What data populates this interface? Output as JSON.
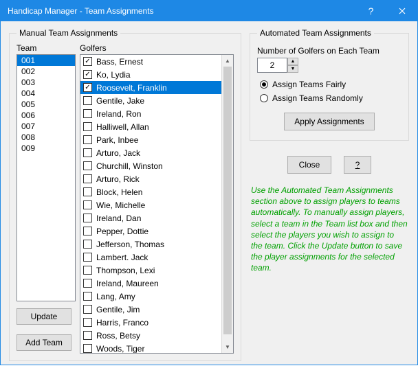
{
  "window": {
    "title": "Handicap Manager - Team Assignments"
  },
  "manual": {
    "legend": "Manual Team Assignments",
    "team_label": "Team",
    "golfers_label": "Golfers",
    "teams": [
      {
        "id": "001",
        "selected": true
      },
      {
        "id": "002",
        "selected": false
      },
      {
        "id": "003",
        "selected": false
      },
      {
        "id": "004",
        "selected": false
      },
      {
        "id": "005",
        "selected": false
      },
      {
        "id": "006",
        "selected": false
      },
      {
        "id": "007",
        "selected": false
      },
      {
        "id": "008",
        "selected": false
      },
      {
        "id": "009",
        "selected": false
      }
    ],
    "golfers": [
      {
        "name": "Bass, Ernest",
        "checked": true,
        "selected": false
      },
      {
        "name": "Ko, Lydia",
        "checked": true,
        "selected": false
      },
      {
        "name": "Roosevelt, Franklin",
        "checked": true,
        "selected": true
      },
      {
        "name": "Gentile, Jake",
        "checked": false,
        "selected": false
      },
      {
        "name": "Ireland, Ron",
        "checked": false,
        "selected": false
      },
      {
        "name": "Halliwell, Allan",
        "checked": false,
        "selected": false
      },
      {
        "name": "Park, Inbee",
        "checked": false,
        "selected": false
      },
      {
        "name": "Arturo, Jack",
        "checked": false,
        "selected": false
      },
      {
        "name": "Churchill, Winston",
        "checked": false,
        "selected": false
      },
      {
        "name": "Arturo, Rick",
        "checked": false,
        "selected": false
      },
      {
        "name": "Block, Helen",
        "checked": false,
        "selected": false
      },
      {
        "name": "Wie, Michelle",
        "checked": false,
        "selected": false
      },
      {
        "name": "Ireland, Dan",
        "checked": false,
        "selected": false
      },
      {
        "name": "Pepper, Dottie",
        "checked": false,
        "selected": false
      },
      {
        "name": "Jefferson, Thomas",
        "checked": false,
        "selected": false
      },
      {
        "name": "Lambert. Jack",
        "checked": false,
        "selected": false
      },
      {
        "name": "Thompson, Lexi",
        "checked": false,
        "selected": false
      },
      {
        "name": "Ireland, Maureen",
        "checked": false,
        "selected": false
      },
      {
        "name": "Lang, Amy",
        "checked": false,
        "selected": false
      },
      {
        "name": "Gentile, Jim",
        "checked": false,
        "selected": false
      },
      {
        "name": "Harris, Franco",
        "checked": false,
        "selected": false
      },
      {
        "name": "Ross, Betsy",
        "checked": false,
        "selected": false
      },
      {
        "name": "Woods, Tiger",
        "checked": false,
        "selected": false
      }
    ],
    "update_label": "Update",
    "add_team_label": "Add Team"
  },
  "automated": {
    "legend": "Automated Team Assignments",
    "num_label": "Number of Golfers on Each Team",
    "num_value": "2",
    "radio_fair": "Assign Teams Fairly",
    "radio_random": "Assign Teams Randomly",
    "radio_selected": "fair",
    "apply_label": "Apply Assignments"
  },
  "actions": {
    "close_label": "Close",
    "help_label": "?"
  },
  "help_text": "Use the Automated Team Assignments section above to assign players to teams automatically. To manually assign players, select a team in the Team list box and then select the players you wish to assign to the team. Click the Update button to save the player assignments for the selected team."
}
